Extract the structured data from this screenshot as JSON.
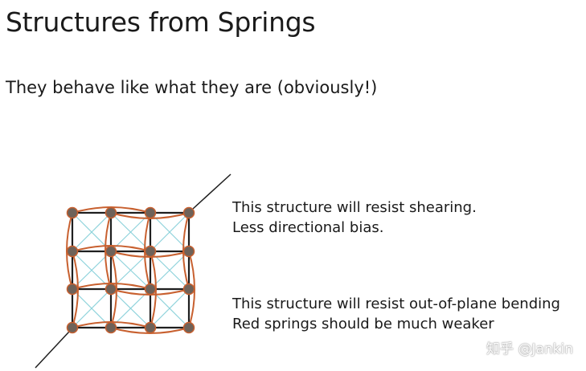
{
  "slide": {
    "title": "Structures from Springs",
    "subtitle": "They behave like what they are (obviously!)"
  },
  "captions": [
    {
      "lines": [
        "This structure will resist shearing.",
        "Less directional bias."
      ]
    },
    {
      "lines": [
        "This structure will resist out-of-plane bending",
        "Red springs should be much weaker"
      ]
    }
  ],
  "watermark": {
    "text": "知乎 @Jankin"
  },
  "colors": {
    "structural_spring": "#1f1f1f",
    "shear_spring": "#8fd3dc",
    "bending_spring": "#c8602f",
    "node_fill": "#6e6259",
    "node_stroke": "#c8602f"
  }
}
